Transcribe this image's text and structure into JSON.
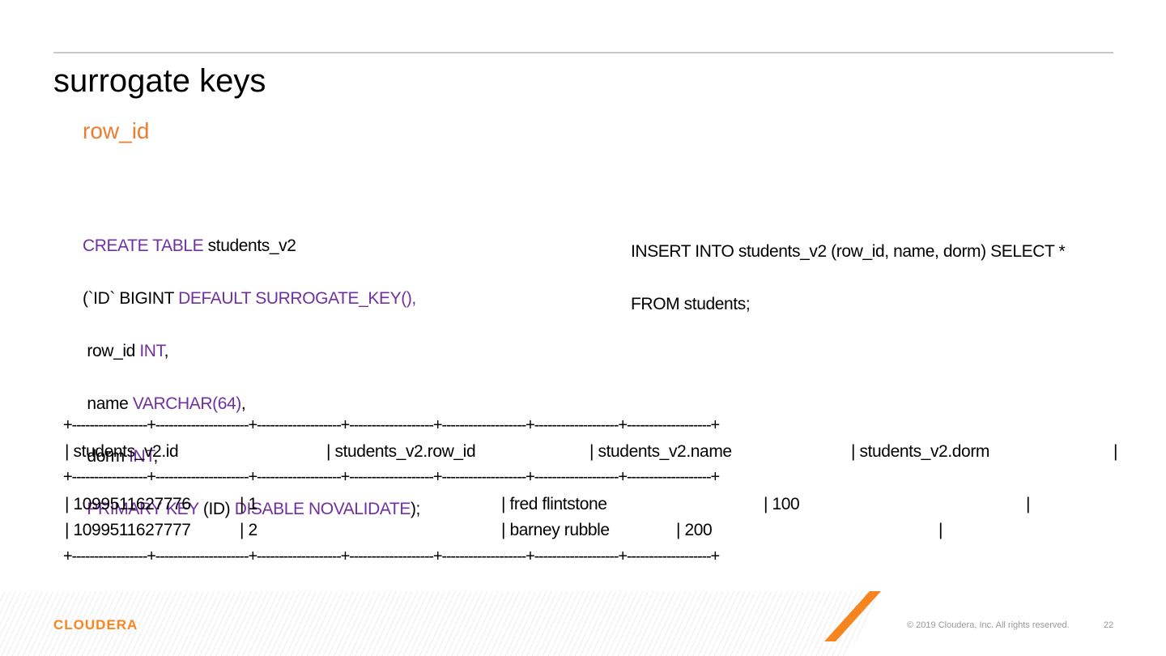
{
  "slide": {
    "title": "surrogate keys",
    "subtitle": "row_id"
  },
  "create_sql": {
    "l1_kw": "CREATE TABLE",
    "l1_rest": " students_v2",
    "l2_a": "(`ID` BIGINT ",
    "l2_kw": "DEFAULT SURROGATE_KEY(),",
    "l3_a": " row_id ",
    "l3_kw": "INT",
    "l3_b": ",",
    "l4_a": " name ",
    "l4_kw": "VARCHAR(64)",
    "l4_b": ",",
    "l5_a": " dorm ",
    "l5_kw": "INT",
    "l5_b": ",",
    "l6_kw1": " PRIMARY KEY",
    "l6_a": " (ID) ",
    "l6_kw2": "DISABLE NOVALIDATE",
    "l6_b": ");"
  },
  "insert_sql": {
    "line1": "INSERT INTO students_v2 (row_id, name, dorm) SELECT *",
    "line2": "FROM students;"
  },
  "result_table": {
    "separator": "+-----------------+---------------------+-------------------+-------------------+-------------------+-------------------+-------------------+",
    "header": [
      "| students_v2.id",
      "| students_v2.row_id",
      "| students_v2.name",
      "| students_v2.dorm",
      "|"
    ],
    "rows": [
      [
        "| 1099511627776",
        "| 1",
        "| fred flintstone",
        "| 100",
        "|"
      ],
      [
        "| 1099511627777",
        "| 2",
        "| barney rubble",
        "| 200",
        "|"
      ]
    ]
  },
  "footer": {
    "logo": "CLOUDERA",
    "copyright": "© 2019 Cloudera, Inc. All rights reserved.",
    "page_number": "22"
  },
  "colors": {
    "accent": "#ed7d31",
    "keyword": "#7030a0",
    "logo": "#f7851f"
  }
}
